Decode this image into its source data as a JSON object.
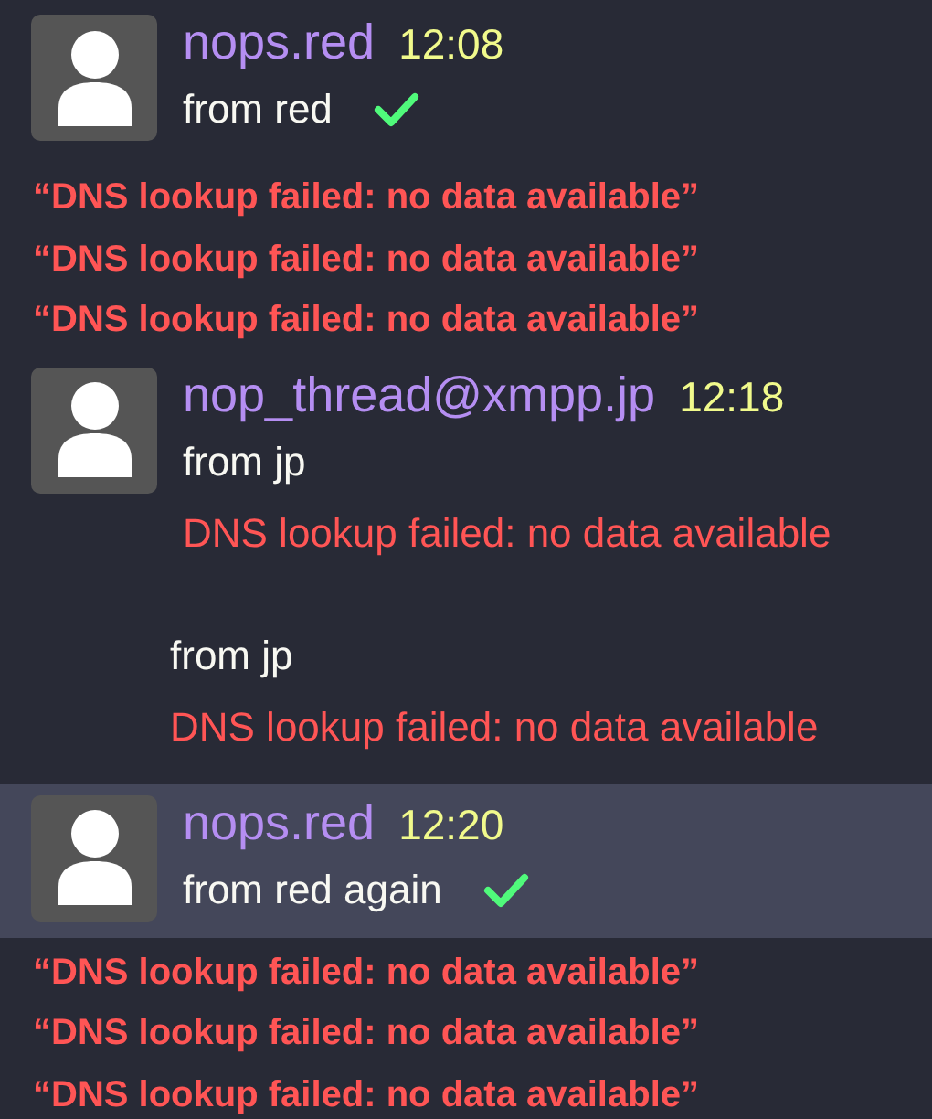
{
  "items": [
    {
      "kind": "message",
      "author": "nops.red",
      "time": "12:08",
      "selected": false,
      "lines": [
        {
          "kind": "text",
          "text": "from red",
          "delivered": true
        }
      ]
    },
    {
      "kind": "errors",
      "lines": [
        "“DNS lookup failed: no data available”",
        "“DNS lookup failed: no data available”",
        "“DNS lookup failed: no data available”"
      ]
    },
    {
      "kind": "message",
      "author": "nop_thread@xmpp.jp",
      "time": "12:18",
      "selected": false,
      "lines": [
        {
          "kind": "text",
          "text": "from jp",
          "delivered": false
        },
        {
          "kind": "error",
          "text": "DNS lookup failed: no data available"
        }
      ]
    },
    {
      "kind": "continuation",
      "lines": [
        {
          "kind": "text",
          "text": "from jp",
          "delivered": false
        },
        {
          "kind": "error",
          "text": "DNS lookup failed: no data available"
        }
      ]
    },
    {
      "kind": "message",
      "author": "nops.red",
      "time": "12:20",
      "selected": true,
      "lines": [
        {
          "kind": "text",
          "text": "from red again",
          "delivered": true
        }
      ]
    },
    {
      "kind": "errors",
      "lines": [
        "“DNS lookup failed: no data available”",
        "“DNS lookup failed: no data available”",
        "“DNS lookup failed: no data available”"
      ]
    }
  ]
}
